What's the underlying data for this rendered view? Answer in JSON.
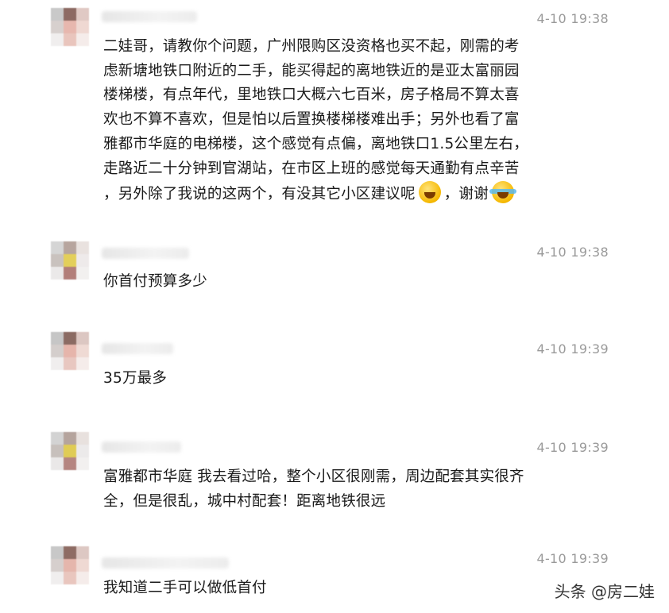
{
  "messages": [
    {
      "time": "4-10 19:38",
      "lines": [
        "二娃哥，请教你个问题，广州限购区没资格也买不起，刚需的考",
        "虑新塘地铁口附近的二手，能买得起的离地铁近的是亚太富丽园",
        "楼梯楼，有点年代，里地铁口大概六七百米，房子格局不算太喜",
        "欢也不算不喜欢，但是怕以后置换楼梯楼难出手；另外也看了富",
        "雅都市华庭的电梯楼，这个感觉有点偏，离地铁口1.5公里左右，",
        "走路近二十分钟到官湖站，在市区上班的感觉每天通勤有点辛苦"
      ],
      "last_line_a": "，另外除了我说的这两个，有没其它小区建议呢",
      "last_line_b": "，谢谢",
      "emoji_1": "grinning-face",
      "emoji_2": "tears-of-joy-face"
    },
    {
      "time": "4-10 19:38",
      "lines": [
        "你首付预算多少"
      ]
    },
    {
      "time": "4-10 19:39",
      "lines": [
        "35万最多"
      ]
    },
    {
      "time": "4-10 19:39",
      "lines": [
        "富雅都市华庭 我去看过哈，整个小区很刚需，周边配套其实很齐",
        "全，但是很乱，城中村配套！距离地铁很远"
      ]
    },
    {
      "time": "4-10 19:39",
      "lines": [
        "我知道二手可以做低首付"
      ]
    }
  ],
  "watermark": "头条 @房二娃"
}
